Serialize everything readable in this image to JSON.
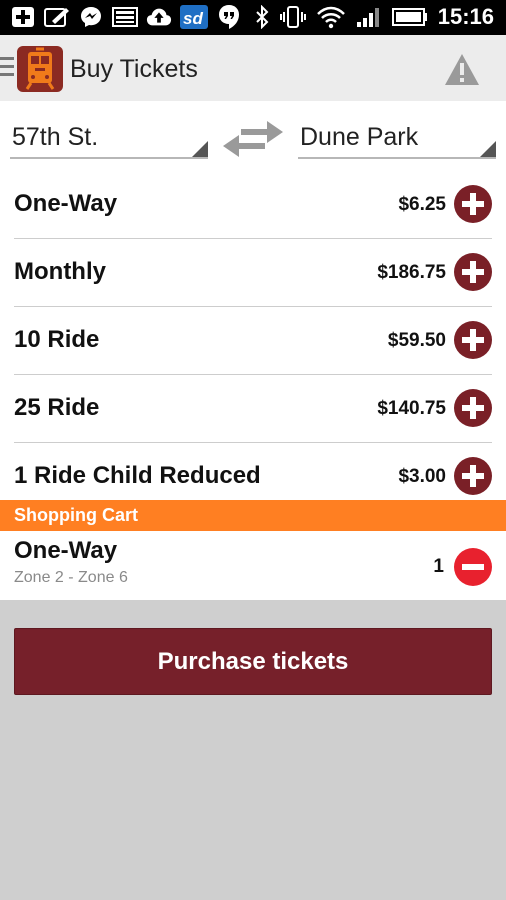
{
  "status_bar": {
    "time": "15:16",
    "left_icons": [
      "plus-box-icon",
      "edit-note-icon",
      "messenger-icon",
      "image-icon",
      "cloud-upload-icon",
      "sd-icon",
      "hangouts-icon"
    ],
    "sd_text": "sd",
    "right_icons": [
      "bluetooth-icon",
      "vibrate-icon",
      "wifi-icon",
      "signal-icon",
      "battery-icon"
    ]
  },
  "action_bar": {
    "title": "Buy Tickets",
    "icons": [
      "menu-icon",
      "train-logo-icon",
      "warning-icon"
    ]
  },
  "stations": {
    "from": "57th St.",
    "to": "Dune Park",
    "swap_icon": "swap-icon"
  },
  "tickets": [
    {
      "name": "One-Way",
      "price": "$6.25"
    },
    {
      "name": "Monthly",
      "price": "$186.75"
    },
    {
      "name": "10 Ride",
      "price": "$59.50"
    },
    {
      "name": "25 Ride",
      "price": "$140.75"
    },
    {
      "name": "1 Ride Child Reduced",
      "price": "$3.00"
    }
  ],
  "cart": {
    "header": "Shopping Cart",
    "items": [
      {
        "name": "One-Way",
        "zones": "Zone 2 - Zone 6",
        "quantity": "1"
      }
    ]
  },
  "purchase_label": "Purchase tickets",
  "colors": {
    "accent": "#76202a",
    "cart_header": "#ff7f22",
    "remove": "#e8212e",
    "background": "#cfcfcf"
  }
}
